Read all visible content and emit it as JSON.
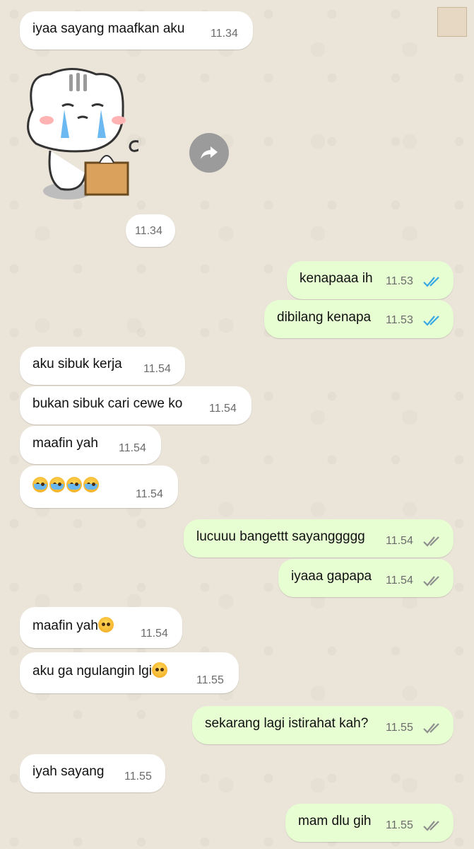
{
  "messages": [
    {
      "type": "in",
      "text": "iyaa sayang maafkan aku",
      "time": "11.34"
    },
    {
      "type": "sticker",
      "time": "11.34"
    },
    {
      "type": "out",
      "text": "kenapaaa ih",
      "time": "11.53",
      "status": "read"
    },
    {
      "type": "out",
      "text": "dibilang kenapa",
      "time": "11.53",
      "status": "read"
    },
    {
      "type": "in",
      "text": "aku sibuk kerja",
      "time": "11.54"
    },
    {
      "type": "in",
      "text": "bukan sibuk cari cewe ko",
      "time": "11.54"
    },
    {
      "type": "in",
      "text": "maafin yah",
      "time": "11.54"
    },
    {
      "type": "in",
      "emoji_count": 4,
      "emoji": "loudly-crying-face",
      "time": "11.54"
    },
    {
      "type": "out",
      "text": "lucuuu bangettt sayanggggg",
      "time": "11.54",
      "status": "delivered"
    },
    {
      "type": "out",
      "text": "iyaaa gapapa",
      "time": "11.54",
      "status": "delivered"
    },
    {
      "type": "in",
      "text": "maafin yah",
      "emoji": "pleading-face",
      "time": "11.54"
    },
    {
      "type": "in",
      "text": "aku ga ngulangin lgi",
      "emoji": "pleading-face",
      "time": "11.55"
    },
    {
      "type": "out",
      "text": "sekarang lagi istirahat kah?",
      "time": "11.55",
      "status": "delivered"
    },
    {
      "type": "in",
      "text": "iyah sayang",
      "time": "11.55"
    },
    {
      "type": "out",
      "text": "mam dlu gih",
      "time": "11.55",
      "status": "delivered"
    }
  ],
  "icons": {
    "forward": "forward-arrow-icon",
    "read_tick_color": "#34a7e4",
    "delivered_tick_color": "#8e8e8e"
  },
  "colors": {
    "incoming_bubble": "#ffffff",
    "outgoing_bubble": "#e7fed3",
    "wallpaper": "#ebe4d9"
  }
}
